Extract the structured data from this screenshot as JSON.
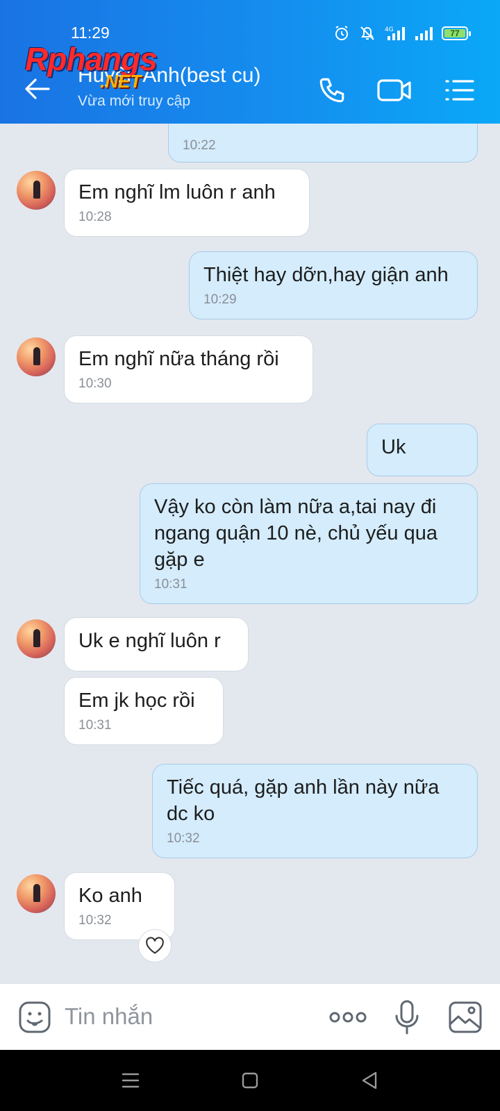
{
  "status_bar": {
    "time": "11:29",
    "network": "4G",
    "battery": "77"
  },
  "header": {
    "contact_name": "Huyền Anh(best cu)",
    "contact_status": "Vừa mới truy cập",
    "accent_color": "#1a73e3"
  },
  "watermark": {
    "main": "Rphangs",
    "sub": ".NET"
  },
  "messages": [
    {
      "from": "me",
      "text": "",
      "time": "10:22"
    },
    {
      "from": "contact",
      "text": "Em nghĩ lm luôn r anh",
      "time": "10:28"
    },
    {
      "from": "me",
      "text": "Thiệt hay dỡn,hay giận anh",
      "time": "10:29"
    },
    {
      "from": "contact",
      "text": "Em nghĩ nữa tháng rồi",
      "time": "10:30"
    },
    {
      "from": "me",
      "text": "Uk",
      "time": ""
    },
    {
      "from": "me",
      "text": "Vậy ko còn làm nữa a,tai nay đi ngang quận 10 nè, chủ yếu qua gặp e",
      "time": "10:31"
    },
    {
      "from": "contact",
      "text": "Uk e nghĩ luôn r",
      "time": ""
    },
    {
      "from": "contact",
      "text": "Em jk học rồi",
      "time": "10:31"
    },
    {
      "from": "me",
      "text": "Tiếc quá, gặp anh lần này nữa dc ko",
      "time": "10:32"
    },
    {
      "from": "contact",
      "text": "Ko anh",
      "time": "10:32"
    }
  ],
  "input": {
    "placeholder": "Tin nhắn"
  },
  "icons": {
    "back": "back-arrow-icon",
    "call": "phone-icon",
    "video": "video-camera-icon",
    "menu": "list-menu-icon",
    "sticker": "sticker-icon",
    "more": "more-dots-icon",
    "mic": "microphone-icon",
    "image": "image-icon",
    "react": "heart-icon"
  }
}
